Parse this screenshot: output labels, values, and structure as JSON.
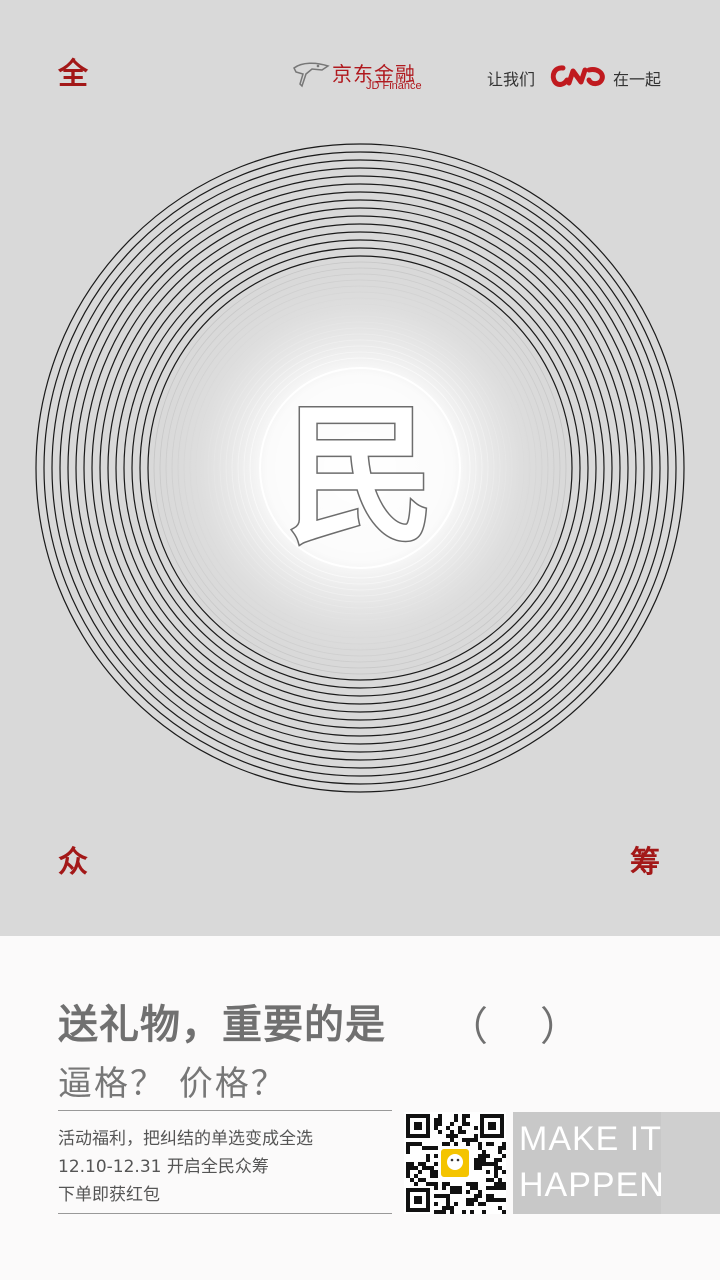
{
  "header": {
    "corner_top_left": "全",
    "brand": {
      "cn": "京东金融",
      "en": "JD Finance"
    },
    "slogan": {
      "prefix": "让我们",
      "suffix": "在一起",
      "logo_icon": "cn-logo-icon"
    }
  },
  "poster": {
    "center_char": "民",
    "corner_bottom_left": "众",
    "corner_bottom_right": "筹"
  },
  "footer": {
    "headline": "送礼物，重要的是",
    "paren_open": "（",
    "paren_close": "）",
    "subhead": "逼格？ 价格？",
    "info_lines": [
      "活动福利，把纠结的单选变成全选",
      "12.10-12.31 开启全民众筹",
      "下单即获红包"
    ],
    "qr_icon": "qr-code-icon",
    "make_it_happen": [
      "MAKE IT",
      "HAPPEN"
    ]
  },
  "colors": {
    "accent": "#a31818",
    "background": "#d9d9d9",
    "footer_bg": "#fbfafa"
  }
}
